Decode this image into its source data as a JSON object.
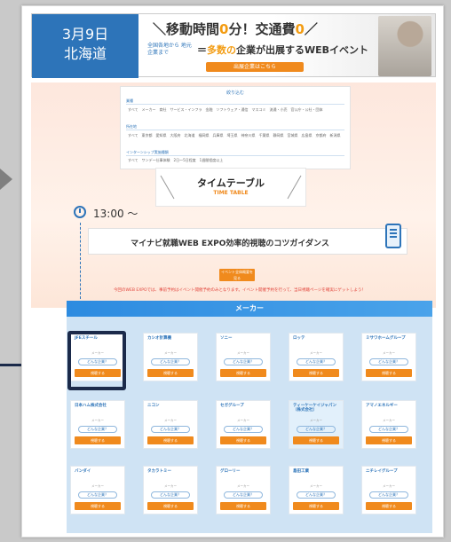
{
  "banner": {
    "date": "3月9日",
    "region": "北海道",
    "headline_pre": "＼移動時間",
    "headline_zero1": "0",
    "headline_mid": "分！交通費",
    "headline_zero2": "0",
    "headline_post": "／",
    "sub_small": "全国各地から 地元企業まで",
    "sub_pre": "＝",
    "sub_accent": "多数の",
    "sub_post": "企業が出展するWEBイベント",
    "cta": "出展企業はこちら"
  },
  "filter": {
    "title": "絞り込む",
    "sections": [
      {
        "label": "業種",
        "items": "すべて　メーカー　商社　サービス・インフラ　金融　ソフトウェア・通信　マスコミ　流通・小売　官公庁・公社・団体"
      },
      {
        "label": "所在地",
        "items": "すべて　東京都　愛知県　大阪府　北海道　福岡県　兵庫県　埼玉県　神奈川県　千葉県　静岡県　宮城県　広島県　京都府　新潟県"
      },
      {
        "label": "インターンシップ実施種類",
        "items": "すべて　ワンデー仕事体験　2日〜5日程度　1週間程度以上"
      }
    ]
  },
  "timetable": {
    "title": "タイムテーブル",
    "subtitle": "TIME TABLE"
  },
  "session": {
    "time": "13:00 〜",
    "title": "マイナビ就職WEB EXPO効率的視聴のコツガイダンス",
    "button": "イベント全体概要を 見る",
    "note": "今回のWEB EXPOでは、事前予約はイベント開催予約のみとなります。イベント開催予約を行って、当日視聴ページを確実にゲットしよう！"
  },
  "makers": {
    "heading": "メーカー",
    "card_maker_label": "メーカー",
    "card_question": "どんな企業？",
    "card_button": "視聴する",
    "companies": [
      "JFEスチール",
      "カシオ計算機",
      "ソニー",
      "ロッテ",
      "ミサワホームグループ",
      "日本ハム株式会社",
      "ニコン",
      "セガグループ",
      "ティーケーケイジャパン（株式会社）",
      "アマノエネルギー",
      "バンダイ",
      "タカラトミー",
      "グローリー",
      "島田工業",
      "ニチレイグループ"
    ]
  },
  "colors": {
    "accent_blue": "#2d74b9",
    "accent_orange": "#f08a1d",
    "callout_navy": "#1b2a4a"
  }
}
